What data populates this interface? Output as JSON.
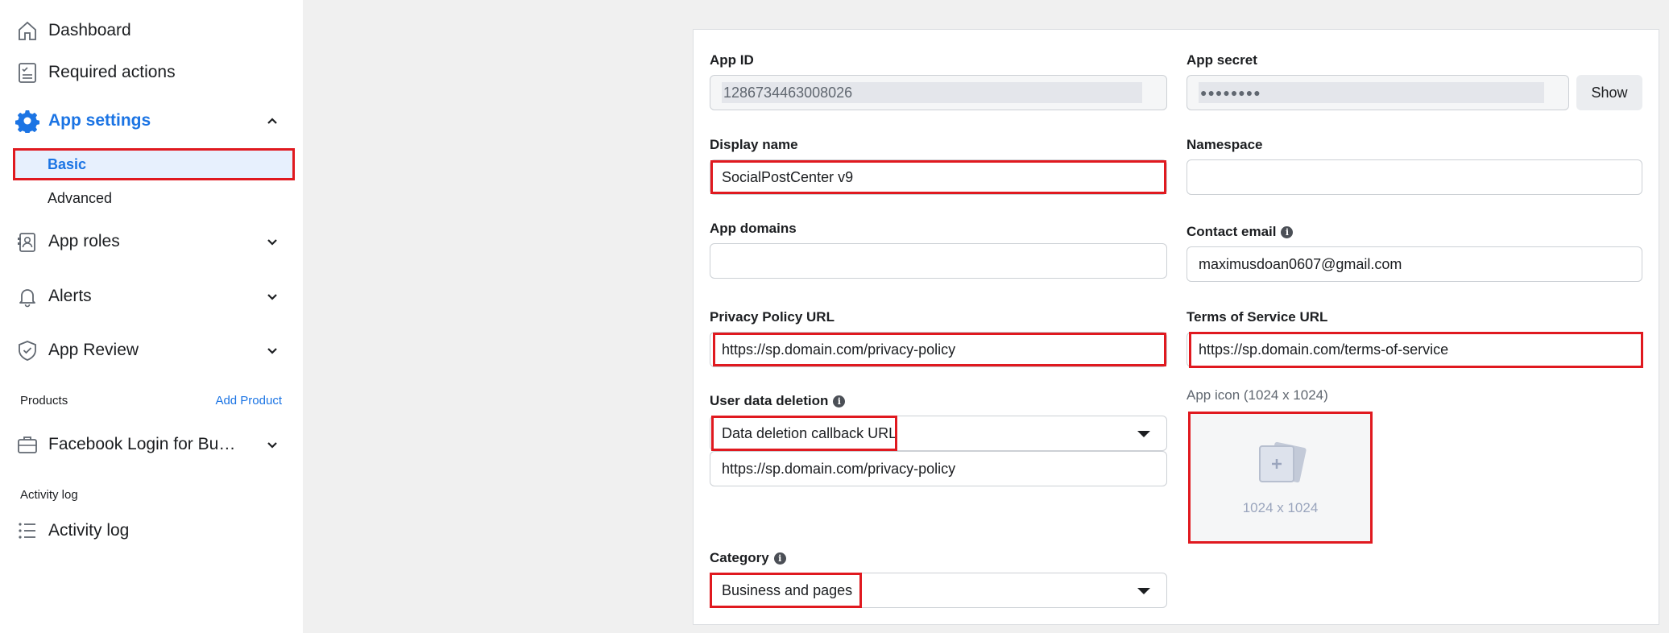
{
  "sidebar": {
    "dashboard": "Dashboard",
    "required_actions": "Required actions",
    "app_settings": "App settings",
    "basic": "Basic",
    "advanced": "Advanced",
    "app_roles": "App roles",
    "alerts": "Alerts",
    "app_review": "App Review",
    "products_header": "Products",
    "add_product": "Add Product",
    "facebook_login": "Facebook Login for Busi…",
    "activity_log_header": "Activity log",
    "activity_log": "Activity log"
  },
  "form": {
    "app_id_label": "App ID",
    "app_id_value": "1286734463008026",
    "app_secret_label": "App secret",
    "app_secret_value": "●●●●●●●●",
    "show_label": "Show",
    "display_name_label": "Display name",
    "display_name_value": "SocialPostCenter v9",
    "namespace_label": "Namespace",
    "namespace_value": "",
    "app_domains_label": "App domains",
    "app_domains_value": "",
    "contact_email_label": "Contact email",
    "contact_email_value": "maximusdoan0607@gmail.com",
    "privacy_label": "Privacy Policy URL",
    "privacy_value": "https://sp.domain.com/privacy-policy",
    "tos_label": "Terms of Service URL",
    "tos_value": "https://sp.domain.com/terms-of-service",
    "user_data_deletion_label": "User data deletion",
    "deletion_select_value": "Data deletion callback URL",
    "deletion_url_value": "https://sp.domain.com/privacy-policy",
    "app_icon_label": "App icon (1024 x 1024)",
    "app_icon_dimensions": "1024 x 1024",
    "category_label": "Category",
    "category_value": "Business and pages"
  },
  "colors": {
    "accent": "#1b74e4",
    "highlight": "#e0191f"
  }
}
